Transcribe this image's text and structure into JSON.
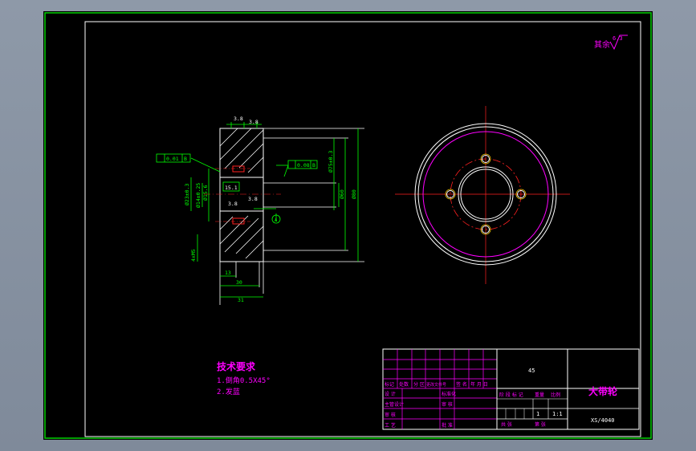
{
  "drawing": {
    "title": "大带轮",
    "drawing_number": "XS/4040",
    "material": "45",
    "scale": "1:1",
    "quantity": "1",
    "roughness_note": "其余",
    "roughness_value": "6.3"
  },
  "requirements": {
    "heading": "技术要求",
    "items": [
      "1.倒角0.5X45°",
      "2.发蓝"
    ]
  },
  "title_block": {
    "row_headers": [
      "标记",
      "处数",
      "分 区",
      "更改文件号",
      "签 名",
      "年 月 日"
    ],
    "designer": "设 计",
    "standardize": "标准化",
    "checker": "审 核",
    "process": "工 艺",
    "approve": "批 准",
    "stage_label": "阶 段 标 记",
    "weight_label": "重量",
    "scale_label": "比例",
    "sheets_label": "共 张",
    "sheet_label": "第 张",
    "main_designer": "主管设计"
  },
  "dimensions": {
    "top_a": "3.8",
    "top_b": "3.8",
    "flatness": "0.01",
    "flatness_ref": "B",
    "runout": "0.08",
    "runout_ref": "B",
    "dia_a": "Ø23±0.3",
    "dia_b": "Ø14±0.25",
    "dia_c": "Ø15.6",
    "dia_outer": "Ø60",
    "dia_max": "Ø80",
    "dia_groove": "Ø75±0.3",
    "mid_value": "15.1",
    "mid_right": "3.8",
    "lower_left": "3.8",
    "width_a": "13",
    "width_b": "30",
    "width_c": "31",
    "chamfer_vertical": "4xM5",
    "datum": "A"
  }
}
